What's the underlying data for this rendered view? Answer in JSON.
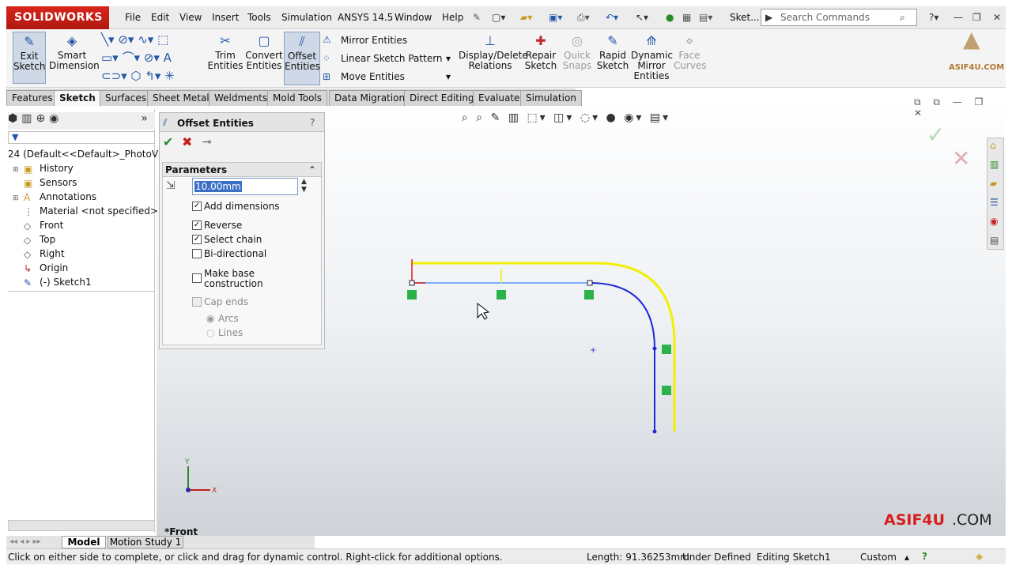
{
  "app": {
    "logo": "SOLIDWORKS",
    "menus": [
      "File",
      "Edit",
      "View",
      "Insert",
      "Tools",
      "Simulation",
      "ANSYS 14.5",
      "Window",
      "Help"
    ],
    "doc_title": "Sket...",
    "search_placeholder": "Search Commands"
  },
  "ribbon": {
    "exit_sketch": "Exit Sketch",
    "smart_dimension": "Smart Dimension",
    "trim": "Trim Entities",
    "convert": "Convert Entities",
    "offset": "Offset Entities",
    "mirror": "Mirror Entities",
    "linear_pattern": "Linear Sketch Pattern",
    "move": "Move Entities",
    "display_delete": "Display/Delete Relations",
    "repair": "Repair Sketch",
    "quick_snaps": "Quick Snaps",
    "rapid": "Rapid Sketch",
    "dynamic_mirror": "Dynamic Mirror Entities",
    "face_curves": "Face Curves",
    "brand": "ASIF4U.COM"
  },
  "tabs": [
    "Features",
    "Sketch",
    "Surfaces",
    "Sheet Metal",
    "Weldments",
    "Mold Tools",
    "Data Migration",
    "Direct Editing",
    "Evaluate",
    "Simulation"
  ],
  "tree": {
    "root": "24 (Default<<Default>_PhotoV",
    "items": [
      "History",
      "Sensors",
      "Annotations",
      "Material <not specified>",
      "Front",
      "Top",
      "Right",
      "Origin",
      "(-) Sketch1"
    ]
  },
  "pm": {
    "title": "Offset Entities",
    "section": "Parameters",
    "distance": "10.00mm",
    "add_dimensions": "Add dimensions",
    "reverse": "Reverse",
    "select_chain": "Select chain",
    "bidirectional": "Bi-directional",
    "make_base_1": "Make base",
    "make_base_2": "construction",
    "cap_ends": "Cap ends",
    "arcs": "Arcs",
    "lines": "Lines"
  },
  "viewport": {
    "view_name": "*Front",
    "watermark_a": "ASIF4U",
    "watermark_b": ".COM",
    "axis_x": "X",
    "axis_y": "Y"
  },
  "bottom_tabs": [
    "Model",
    "Motion Study 1"
  ],
  "status": {
    "hint": "Click on either side to complete, or click and drag for dynamic control.  Right-click for additional options.",
    "length": "Length: 91.36253mm",
    "defined": "Under Defined",
    "editing": "Editing Sketch1",
    "units": "Custom"
  }
}
